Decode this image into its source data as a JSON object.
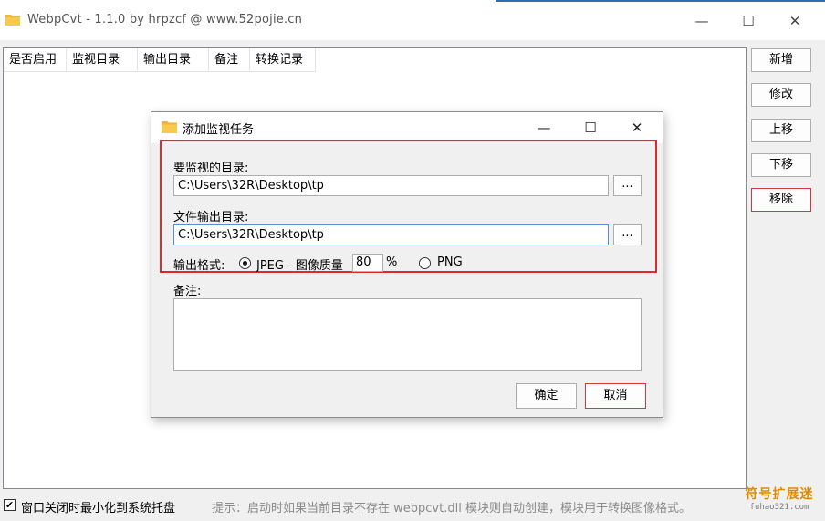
{
  "window": {
    "title": "WebpCvt - 1.1.0 by hrpzcf @ www.52pojie.cn",
    "minimize": "—",
    "maximize": "☐",
    "close": "✕"
  },
  "list": {
    "columns": [
      "是否启用",
      "监视目录",
      "输出目录",
      "备注",
      "转换记录"
    ],
    "rows": []
  },
  "side_buttons": {
    "add": "新增",
    "edit": "修改",
    "move_up": "上移",
    "move_down": "下移",
    "remove": "移除"
  },
  "footer": {
    "minimize_to_tray_checked": true,
    "minimize_to_tray_label": "窗口关闭时最小化到系统托盘",
    "hint": "提示：启动时如果当前目录不存在 webpcvt.dll 模块则自动创建，模块用于转换图像格式。"
  },
  "watermark": {
    "main": "符号扩展迷",
    "sub": "fuhao321.com"
  },
  "dialog": {
    "title": "添加监视任务",
    "minimize": "—",
    "maximize": "☐",
    "close": "✕",
    "watch_dir_label": "要监视的目录:",
    "watch_dir_value": "C:\\Users\\32R\\Desktop\\tp",
    "output_dir_label": "文件输出目录:",
    "output_dir_value": "C:\\Users\\32R\\Desktop\\tp",
    "browse_label": "...",
    "format_label": "输出格式:",
    "format_jpeg_label": "JPEG - 图像质量",
    "jpeg_quality": "80",
    "percent": "%",
    "format_png_label": "PNG",
    "selected_format": "JPEG",
    "note_label": "备注:",
    "note_value": "",
    "ok_label": "确定",
    "cancel_label": "取消"
  },
  "colors": {
    "highlight": "#e02a2a",
    "remove_border": "#d0393e",
    "watermark": "#e08a00"
  }
}
